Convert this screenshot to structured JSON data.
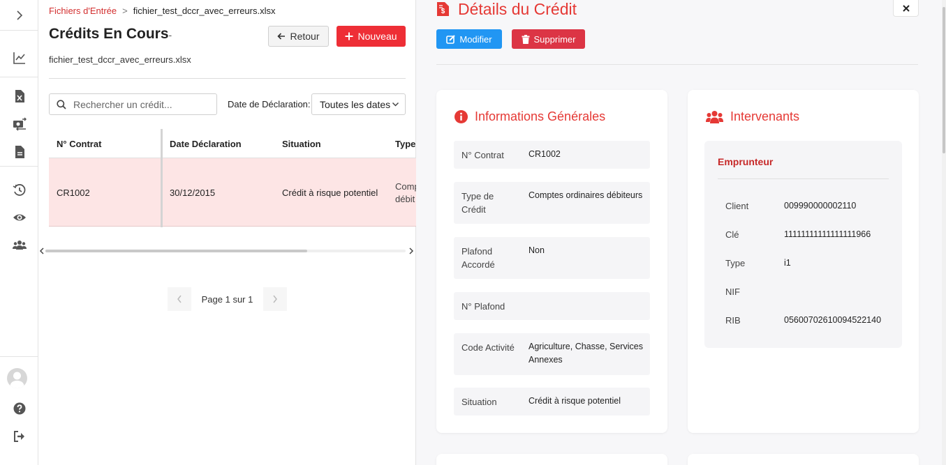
{
  "sidebar": {
    "toggle_icon": "chevron-right-icon",
    "items": [
      {
        "icon": "chart-line-icon"
      },
      {
        "icon": "file-excel-icon"
      },
      {
        "icon": "money-exchange-icon"
      },
      {
        "icon": "file-icon"
      },
      {
        "icon": "history-icon"
      },
      {
        "icon": "eye-icon"
      },
      {
        "icon": "users-icon"
      }
    ],
    "bottom": [
      {
        "icon": "avatar"
      },
      {
        "icon": "question-circle-icon"
      },
      {
        "icon": "sign-out-icon"
      }
    ]
  },
  "breadcrumb": {
    "link": "Fichiers d'Entrée",
    "separator": ">",
    "current": "fichier_test_dccr_avec_erreurs.xlsx"
  },
  "left": {
    "title": "Crédits En Cours",
    "title_suffix": "-",
    "file_name": "fichier_test_dccr_avec_erreurs.xlsx",
    "retour_label": "Retour",
    "nouveau_label": "Nouveau",
    "search_placeholder": "Rechercher un crédit...",
    "date_label": "Date de Déclaration:",
    "date_value": "Toutes les dates",
    "table": {
      "headers": [
        "N° Contrat",
        "Date Déclaration",
        "Situation",
        "Type"
      ],
      "rows": [
        {
          "contrat": "CR1002",
          "date": "30/12/2015",
          "situation": "Crédit à risque potentiel",
          "type_l1": "Comp",
          "type_l2": "débit"
        }
      ]
    },
    "pager_text": "Page 1 sur 1"
  },
  "details": {
    "title": "Détails du Crédit",
    "modifier_label": "Modifier",
    "supprimer_label": "Supprimer",
    "general": {
      "title": "Informations Générales",
      "rows": [
        {
          "label": "N° Contrat",
          "value": "CR1002"
        },
        {
          "label": "Type de Crédit",
          "value": "Comptes ordinaires débiteurs"
        },
        {
          "label": "Plafond Accordé",
          "value": "Non"
        },
        {
          "label": "N° Plafond",
          "value": ""
        },
        {
          "label": "Code Activité",
          "value": "Agriculture, Chasse, Services Annexes"
        },
        {
          "label": "Situation",
          "value": "Crédit à risque potentiel"
        }
      ]
    },
    "intervenants": {
      "title": "Intervenants",
      "emprunteur_title": "Emprunteur",
      "fields": [
        {
          "label": "Client",
          "value": "009990000002110"
        },
        {
          "label": "Clé",
          "value": "11111111111111111966"
        },
        {
          "label": "Type",
          "value": "i1"
        },
        {
          "label": "NIF",
          "value": ""
        },
        {
          "label": "RIB",
          "value": "05600702610094522140"
        }
      ]
    }
  },
  "colors": {
    "accent_red": "#e53935",
    "new_button": "#ee2e36",
    "modify_button": "#2196f3",
    "delete_button": "#dc3545",
    "selected_row": "#fde5e5"
  }
}
